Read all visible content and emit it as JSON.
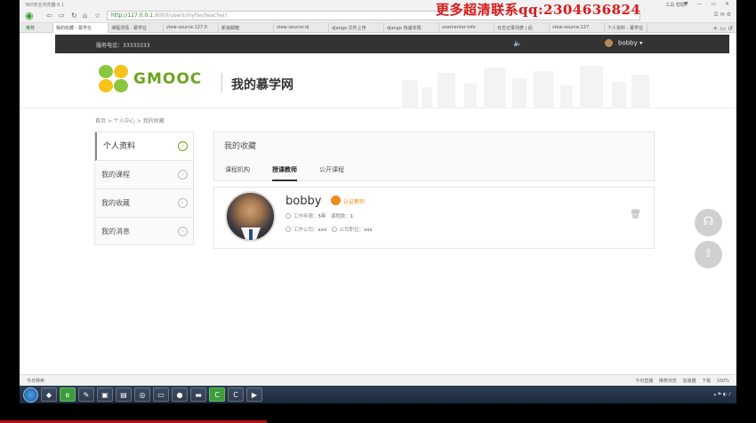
{
  "browser": {
    "app_name": "360安全浏览器 8.1",
    "url_host": "http://127.0.0.1",
    "url_path": ":8000/users/myfav/teacher/",
    "menu": "工具  帮助",
    "window_controls": "▼ — ▭ ✕",
    "tabs": [
      "推荐",
      "我的收藏 - 慕学在",
      "课程详情 - 慕学在",
      "view-source:127.0",
      "新浪邮箱",
      "view-source:dj",
      "django 文件上传",
      "django 快速实现",
      "usercenter-info",
      "日志记录列表 | 后",
      "view-source:127",
      "个人资料 - 慕学在"
    ]
  },
  "promo_text": "更多超清联系qq:2304636824",
  "site_top": {
    "phone": "服务电话：33333333",
    "username": "bobby ▾"
  },
  "header": {
    "logo_text": "GMOOC",
    "title": "我的慕学网"
  },
  "breadcrumb": "首页 > 个人中心 > 我的收藏",
  "sidebar": {
    "items": [
      {
        "label": "个人资料"
      },
      {
        "label": "我的课程"
      },
      {
        "label": "我的收藏"
      },
      {
        "label": "我的消息"
      }
    ]
  },
  "favorites": {
    "title": "我的收藏",
    "tabs": [
      "课程机构",
      "授课教师",
      "公开课程"
    ]
  },
  "teacher": {
    "name": "bobby",
    "badge": "认证教师",
    "work_years_label": "工作年限：",
    "work_years": "5年",
    "courses_label": "课程数：",
    "courses": "1",
    "company_label": "工作公司：",
    "company": "xxx",
    "position_label": "公司职位：",
    "position": "xxx"
  },
  "statusbar": {
    "left": "今日特卖",
    "right": "今日直播 推荐浏览 加速器 下载 100%"
  },
  "colors": {
    "brand_green": "#6ea41e",
    "badge_orange": "#f08a1d",
    "topbar": "#333333",
    "promo_red": "#d81b1b"
  }
}
